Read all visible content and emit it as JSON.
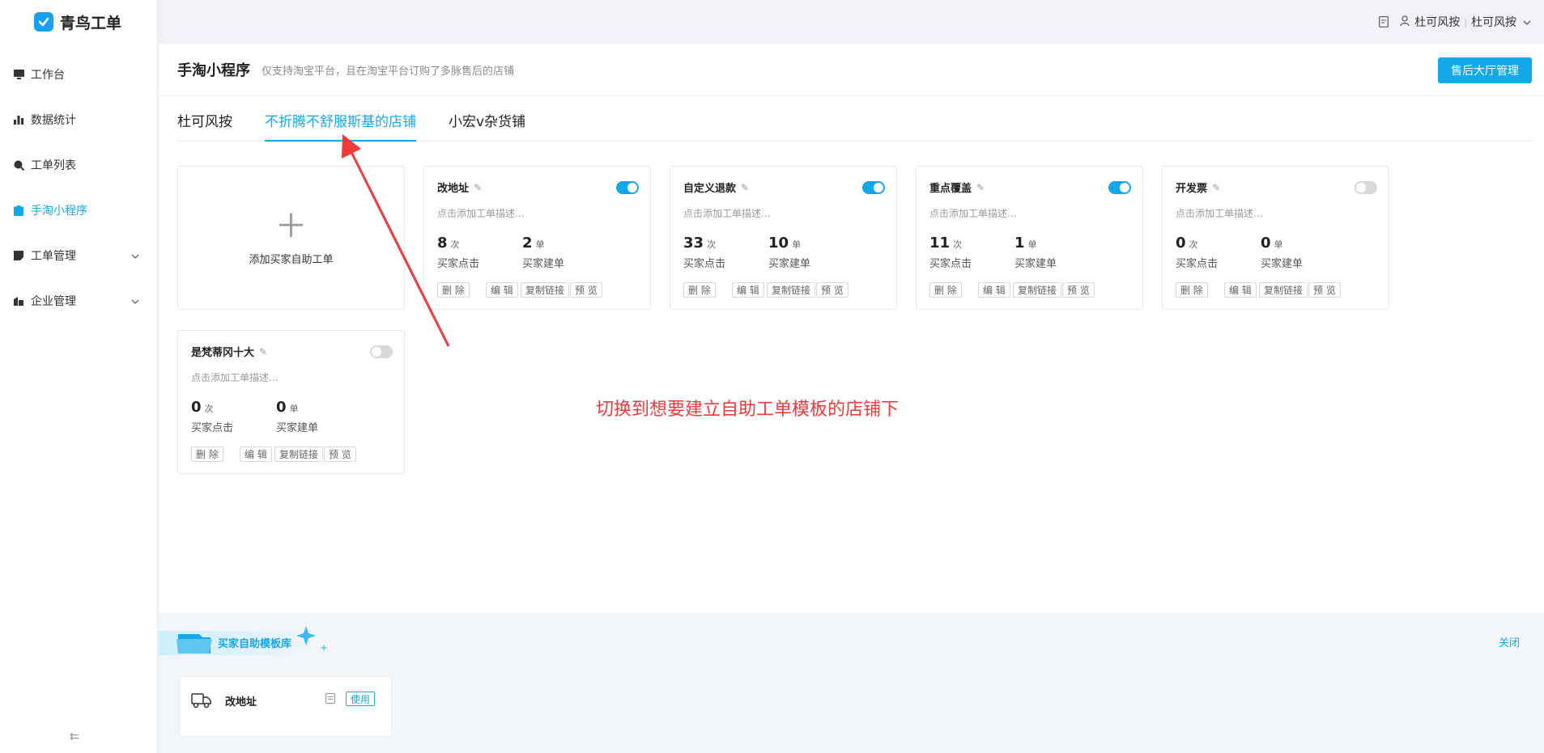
{
  "app": {
    "name": "青鸟工单"
  },
  "topbar": {
    "user_label": "杜可风按",
    "store_label": "杜可风按"
  },
  "sidebar": {
    "items": [
      {
        "label": "工作台"
      },
      {
        "label": "数据统计"
      },
      {
        "label": "工单列表"
      },
      {
        "label": "手淘小程序"
      },
      {
        "label": "工单管理"
      },
      {
        "label": "企业管理"
      }
    ],
    "collapse_label": "⇇"
  },
  "page": {
    "title": "手淘小程序",
    "subtitle": "仅支持淘宝平台，且在淘宝平台订购了多脉售后的店铺",
    "action_button": "售后大厅管理"
  },
  "tabs": [
    {
      "label": "杜可风按"
    },
    {
      "label": "不折腾不舒服斯基的店铺"
    },
    {
      "label": "小宏v杂货铺"
    }
  ],
  "add_card": {
    "label": "添加买家自助工单"
  },
  "cards": [
    {
      "title": "改地址",
      "enabled": true,
      "desc": "点击添加工单描述...",
      "clicks": "8",
      "clicks_unit": "次",
      "clicks_label": "买家点击",
      "orders": "2",
      "orders_unit": "单",
      "orders_label": "买家建单"
    },
    {
      "title": "自定义退款",
      "enabled": true,
      "desc": "点击添加工单描述...",
      "clicks": "33",
      "clicks_unit": "次",
      "clicks_label": "买家点击",
      "orders": "10",
      "orders_unit": "单",
      "orders_label": "买家建单"
    },
    {
      "title": "重点覆盖",
      "enabled": true,
      "desc": "点击添加工单描述...",
      "clicks": "11",
      "clicks_unit": "次",
      "clicks_label": "买家点击",
      "orders": "1",
      "orders_unit": "单",
      "orders_label": "买家建单"
    },
    {
      "title": "开发票",
      "enabled": false,
      "desc": "点击添加工单描述...",
      "clicks": "0",
      "clicks_unit": "次",
      "clicks_label": "买家点击",
      "orders": "0",
      "orders_unit": "单",
      "orders_label": "买家建单"
    },
    {
      "title": "是梵蒂冈十大",
      "enabled": false,
      "desc": "点击添加工单描述...",
      "clicks": "0",
      "clicks_unit": "次",
      "clicks_label": "买家点击",
      "orders": "0",
      "orders_unit": "单",
      "orders_label": "买家建单"
    }
  ],
  "card_actions": {
    "delete": "删 除",
    "edit": "编 辑",
    "copy_link": "复制链接",
    "preview": "预 览"
  },
  "annotation": {
    "text": "切换到想要建立自助工单模板的店铺下",
    "color": "#f03a3a"
  },
  "library": {
    "title": "买家自助模板库",
    "close_label": "关闭",
    "templates": [
      {
        "name": "改地址",
        "use_label": "使用"
      }
    ]
  },
  "colors": {
    "accent": "#13a8e8",
    "annotation": "#f03a3a"
  }
}
